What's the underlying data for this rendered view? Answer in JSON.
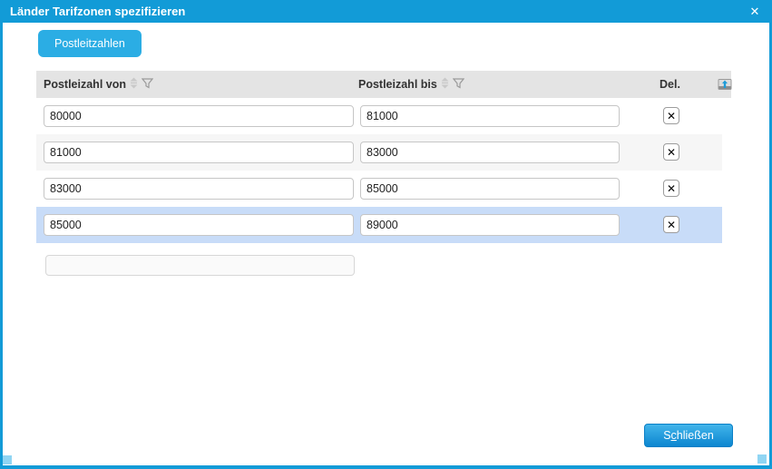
{
  "window": {
    "title": "Länder Tarifzonen spezifizieren"
  },
  "icons": {
    "close": "✕",
    "delete": "✕"
  },
  "tab": {
    "label": "Postleitzahlen"
  },
  "grid": {
    "columns": {
      "von": "Postleizahl von",
      "bis": "Postleizahl bis",
      "del": "Del."
    },
    "rows": [
      {
        "von": "80000",
        "bis": "81000",
        "selected": false
      },
      {
        "von": "81000",
        "bis": "83000",
        "selected": false
      },
      {
        "von": "83000",
        "bis": "85000",
        "selected": false
      },
      {
        "von": "85000",
        "bis": "89000",
        "selected": true
      }
    ],
    "new_row": {
      "von": ""
    }
  },
  "footer": {
    "close_button": {
      "prefix": "S",
      "accesskey": "c",
      "suffix": "hließen"
    }
  },
  "colors": {
    "titlebar": "#129bd7",
    "border": "#129bd7",
    "tab": "#2bade4",
    "header_bg": "#e4e4e4",
    "stripe_row": "#f6f6f6",
    "selected_row": "#c8dcf8",
    "button_top": "#41b4ea",
    "button_bottom": "#0c86d0",
    "grip": "#90d5f3"
  }
}
